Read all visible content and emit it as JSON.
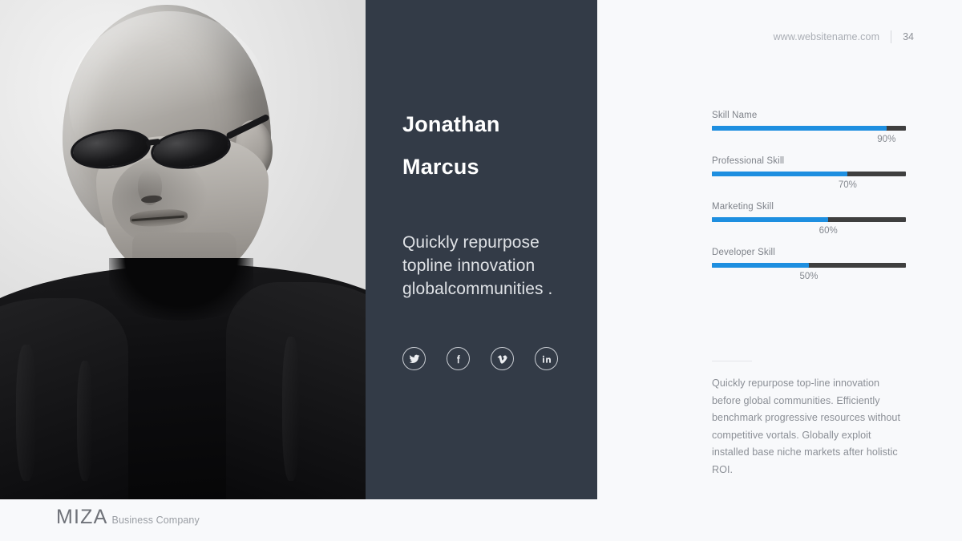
{
  "header": {
    "site_url": "www.websitename.com",
    "page_number": "34"
  },
  "profile": {
    "first_name": "Jonathan",
    "last_name": "Marcus",
    "tagline": "Quickly repurpose topline innovation globalcommunities ."
  },
  "socials": [
    {
      "name": "twitter",
      "label": "Twitter"
    },
    {
      "name": "facebook",
      "label": "Facebook"
    },
    {
      "name": "vimeo",
      "label": "Vimeo"
    },
    {
      "name": "linkedin",
      "label": "LinkedIn"
    }
  ],
  "skills": [
    {
      "label": "Skill Name",
      "value": "90%",
      "percent": 90
    },
    {
      "label": "Professional Skill",
      "value": "70%",
      "percent": 70
    },
    {
      "label": "Marketing Skill",
      "value": "60%",
      "percent": 60
    },
    {
      "label": "Developer Skill",
      "value": "50%",
      "percent": 50
    }
  ],
  "about": {
    "paragraph": "Quickly repurpose top-line innovation before global communities. Efficiently benchmark progressive resources without competitive vortals. Globally exploit installed base niche markets after holistic ROI."
  },
  "footer": {
    "brand_mark": "MIZA",
    "brand_sub": "Business Company"
  },
  "colors": {
    "panel_dark": "#333b47",
    "accent_blue": "#1e8fe0",
    "bar_track": "#3f3f3f",
    "page_bg": "#f8f9fb"
  },
  "chart_data": {
    "type": "bar",
    "title": "",
    "categories": [
      "Skill Name",
      "Professional Skill",
      "Marketing Skill",
      "Developer Skill"
    ],
    "values": [
      90,
      70,
      60,
      50
    ],
    "xlabel": "",
    "ylabel": "",
    "ylim": [
      0,
      100
    ],
    "orientation": "horizontal",
    "grid": false,
    "legend": "none"
  }
}
